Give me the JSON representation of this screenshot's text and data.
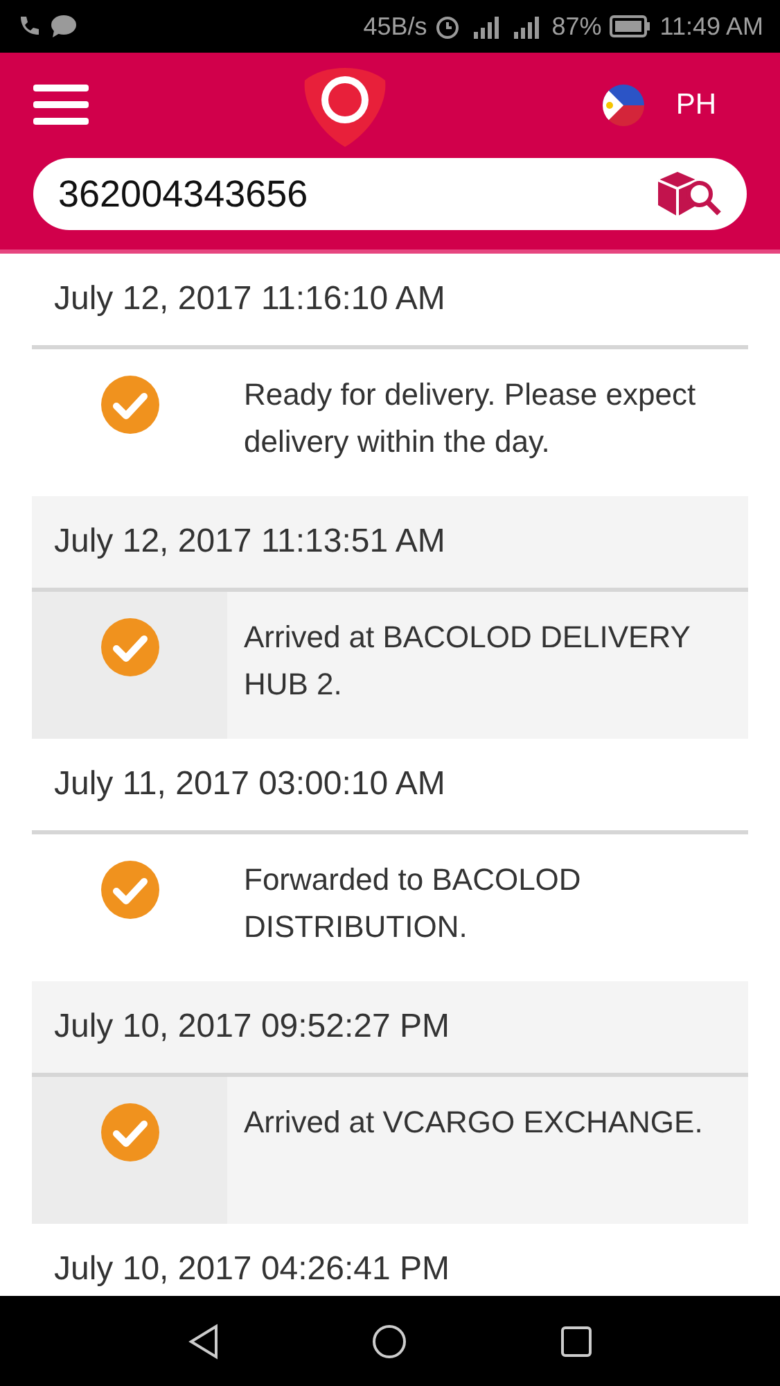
{
  "status_bar": {
    "speed": "45B/s",
    "battery": "87%",
    "time": "11:49 AM"
  },
  "header": {
    "country": "PH"
  },
  "search": {
    "value": "362004343656"
  },
  "events": [
    {
      "date": "July 12, 2017 11:16:10 AM",
      "status": "Ready for delivery. Please expect delivery within the day.",
      "done": true
    },
    {
      "date": "July 12, 2017 11:13:51 AM",
      "status": "Arrived at BACOLOD DELIVERY HUB 2.",
      "done": true
    },
    {
      "date": "July 11, 2017 03:00:10 AM",
      "status": "Forwarded to BACOLOD DISTRIBUTION.",
      "done": true
    },
    {
      "date": "July 10, 2017 09:52:27 PM",
      "status": "Arrived at VCARGO EXCHANGE.",
      "done": true
    },
    {
      "date": "July 10, 2017 04:26:41 PM"
    }
  ]
}
